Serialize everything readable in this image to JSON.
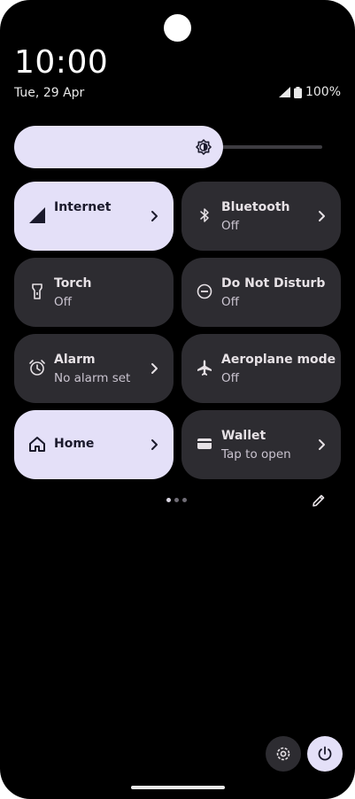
{
  "status_bar": {
    "time": "10:00",
    "date": "Tue, 29 Apr",
    "battery": "100%"
  },
  "brightness": {
    "level": 0.62
  },
  "tiles": [
    {
      "label": "Internet",
      "sub": "",
      "state": "on",
      "has_chevron": true,
      "icon": "signal-icon"
    },
    {
      "label": "Bluetooth",
      "sub": "Off",
      "state": "off",
      "has_chevron": true,
      "icon": "bluetooth-icon"
    },
    {
      "label": "Torch",
      "sub": "Off",
      "state": "off",
      "has_chevron": false,
      "icon": "torch-icon"
    },
    {
      "label": "Do Not Disturb",
      "sub": "Off",
      "state": "off",
      "has_chevron": false,
      "icon": "dnd-icon"
    },
    {
      "label": "Alarm",
      "sub": "No alarm set",
      "state": "off",
      "has_chevron": true,
      "icon": "alarm-icon"
    },
    {
      "label": "Aeroplane mode",
      "sub": "Off",
      "state": "off",
      "has_chevron": false,
      "icon": "aeroplane-icon"
    },
    {
      "label": "Home",
      "sub": "",
      "state": "on",
      "has_chevron": true,
      "icon": "home-icon"
    },
    {
      "label": "Wallet",
      "sub": "Tap to open",
      "state": "off",
      "has_chevron": true,
      "icon": "wallet-icon"
    }
  ],
  "pager": {
    "pages": 3,
    "current": 1
  },
  "colors": {
    "tile_on": "#e4e0f8",
    "tile_off": "#2d2c31",
    "background": "#000000"
  }
}
